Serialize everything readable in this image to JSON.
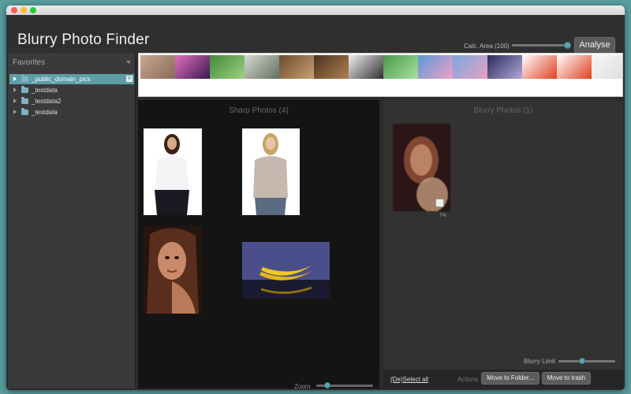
{
  "app": {
    "title": "Blurry Photo Finder"
  },
  "header": {
    "calc_area_label": "Calc. Area (100)",
    "analyse_label": "Analyse",
    "calc_area_value_fraction": 0.9
  },
  "sidebar": {
    "favorites_label": "Favorites",
    "items": [
      {
        "label": "_public_domain_pics",
        "selected": true
      },
      {
        "label": "_testdata",
        "selected": false
      },
      {
        "label": "_testdata2",
        "selected": false
      },
      {
        "label": "_testdata",
        "selected": false
      }
    ]
  },
  "filmstrip": {
    "thumb_colors": [
      [
        "#c8a890",
        "#8a6a58"
      ],
      [
        "#e26fc0",
        "#3a1850"
      ],
      [
        "#3f8a3a",
        "#a0d080"
      ],
      [
        "#d8d8d0",
        "#607060"
      ],
      [
        "#6a4a30",
        "#c8a070"
      ],
      [
        "#4a3220",
        "#b08050"
      ],
      [
        "#f0f0f0",
        "#303030"
      ],
      [
        "#4a9a4a",
        "#a8e0a0"
      ],
      [
        "#5a9ad8",
        "#f0a0c8"
      ],
      [
        "#7aa8e0",
        "#e8a0c0"
      ],
      [
        "#2a2a5a",
        "#b0a8d8"
      ],
      [
        "#ffffff",
        "#e04020"
      ],
      [
        "#ffffff",
        "#e04020"
      ],
      [
        "#f6f6f6",
        "#dddddd"
      ]
    ]
  },
  "sharp_panel": {
    "title": "Sharp Photos (4)",
    "zoom_label": "Zoom",
    "zoom_value_fraction": 0.2
  },
  "blurry_panel": {
    "title": "Blurry Photos (1)",
    "photo_percent": "7%",
    "blurry_limit_label": "Blurry Limit",
    "blurry_limit_fraction": 0.4
  },
  "actionbar": {
    "select_all_label": "(De)Select all",
    "actions_label": "Actions",
    "move_folder_label": "Move to Folder...",
    "move_trash_label": "Move to trash"
  },
  "colors": {
    "accent": "#5b9ea6",
    "window_bg": "#2b2b2b",
    "sharp_bg": "#141414",
    "blurry_bg": "#323232"
  }
}
